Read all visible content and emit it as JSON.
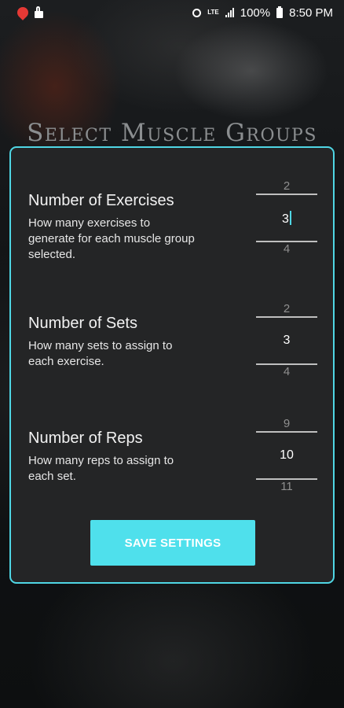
{
  "status_bar": {
    "battery": "100%",
    "time": "8:50 PM",
    "network": "LTE"
  },
  "heading": "Select Muscle Groups",
  "settings": [
    {
      "title": "Number of Exercises",
      "description": "How many exercises to generate for each muscle group selected.",
      "prev": "2",
      "value": "3",
      "next": "4"
    },
    {
      "title": "Number of Sets",
      "description": "How many sets to assign to each exercise.",
      "prev": "2",
      "value": "3",
      "next": "4"
    },
    {
      "title": "Number of Reps",
      "description": "How many reps to assign to each set.",
      "prev": "9",
      "value": "10",
      "next": "11"
    }
  ],
  "save_button": "SAVE SETTINGS",
  "colors": {
    "accent": "#4fd6e4",
    "button": "#4fe0ec",
    "panel": "#242526"
  }
}
